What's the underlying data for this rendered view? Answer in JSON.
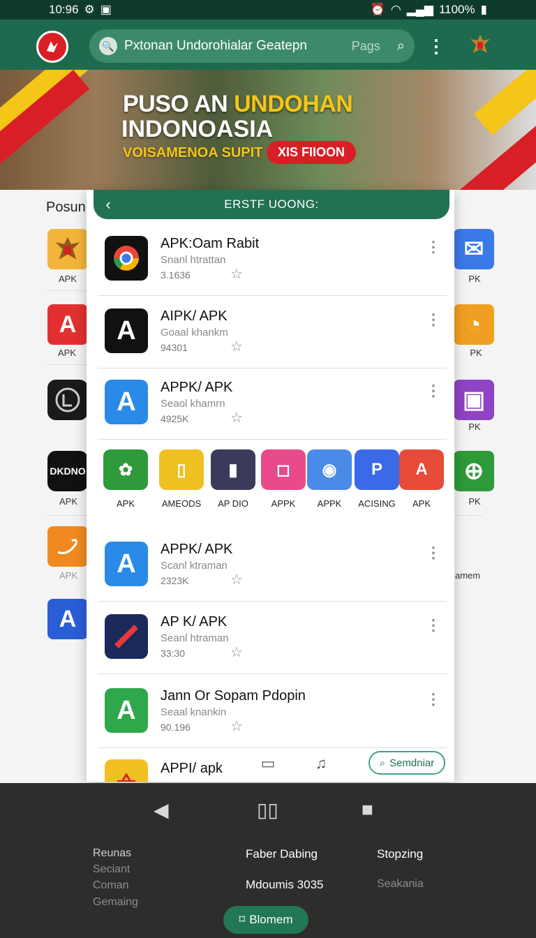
{
  "status_bar": {
    "time": "10:96",
    "battery": "1100%"
  },
  "header": {
    "search_text": "Pxtonan Undorohialar Geatepn",
    "search_page": "Pags"
  },
  "banner": {
    "title_white": "PUSO AN ",
    "title_accent": "UNDOHAN",
    "title_line2": "INDONOASIA",
    "subtitle": "VOISAMENOA SUPIT",
    "badge": "XIS FIIOON"
  },
  "background": {
    "section_title": "Posun",
    "labels": [
      "APK",
      "APK",
      "APK",
      "APK",
      "PK",
      "PK",
      "PK",
      "PK"
    ],
    "right_text": "amem"
  },
  "panel": {
    "title": "ERSTF UOONG:",
    "apps": [
      {
        "name": "APK:Oam Rabit",
        "dev": "Snanl htrattan",
        "size": "3.1636"
      },
      {
        "name": "AIPK/ APK",
        "dev": "Goaal khankm",
        "size": "94301"
      },
      {
        "name": "APPK/ APK",
        "dev": "Seaol khamrn",
        "size": "4925K"
      },
      {
        "name": "APPK/ APK",
        "dev": "Scanl ktraman",
        "size": "2323K"
      },
      {
        "name": "AP K/ APK",
        "dev": "Seanl htraman",
        "size": "33:30"
      },
      {
        "name": "Jann Or Sopam Pdopin",
        "dev": "Seaal knankin",
        "size": "90.196"
      },
      {
        "name": "APPI/ apk"
      }
    ],
    "featured": [
      {
        "label": "APK",
        "icon": "leaf-app-icon",
        "color": "#2e9a3a"
      },
      {
        "label": "AMEODS",
        "icon": "phone-app-icon",
        "color": "#f0c020"
      },
      {
        "label": "AP DIO",
        "icon": "device-app-icon",
        "color": "#3a3a5a"
      },
      {
        "label": "APPK",
        "icon": "pink-app-icon",
        "color": "#e84a8a"
      },
      {
        "label": "APPK",
        "icon": "browser-app-icon",
        "color": "#4a8ae8"
      },
      {
        "label": "ACISING",
        "icon": "p-app-icon",
        "color": "#3a6ae8"
      },
      {
        "label": "APK",
        "icon": "a-app-icon",
        "color": "#e84a3a"
      }
    ],
    "send_label": "Semdniar"
  },
  "footer": {
    "col1": [
      "Reunas",
      "Seciant",
      "Coman",
      "Gemaing"
    ],
    "col2": [
      "Faber Dabing",
      "Mdoumis 3035"
    ],
    "col3": [
      "Stopzing",
      "Seakania"
    ],
    "cta": "Blomem"
  }
}
